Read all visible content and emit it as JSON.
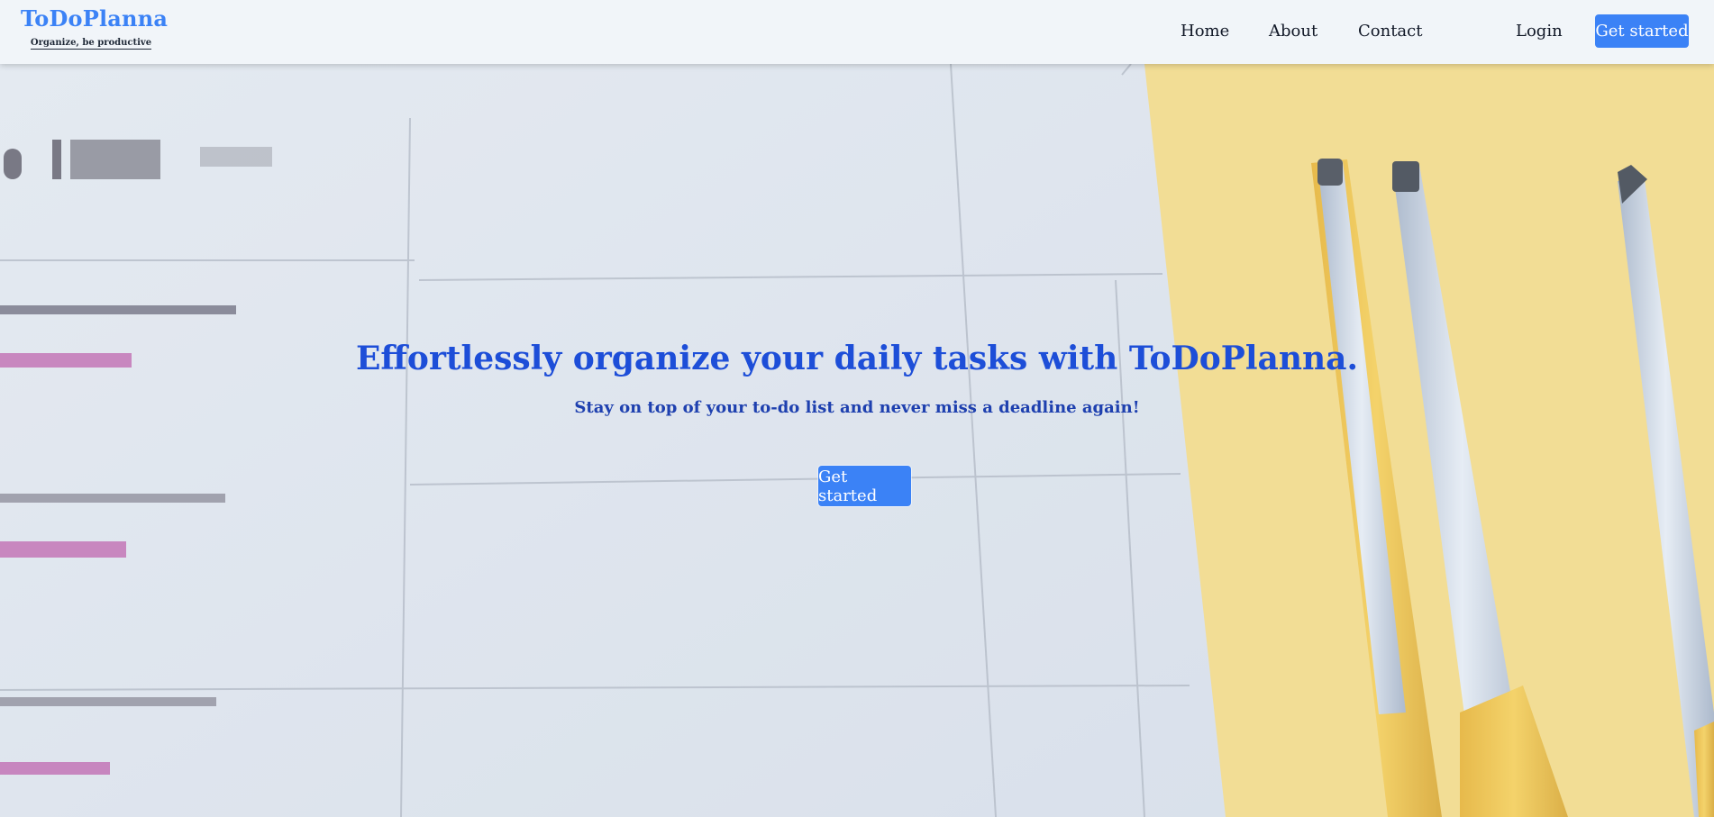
{
  "brand": {
    "name": "ToDoPlanna",
    "tagline": "Organize, be productive"
  },
  "nav": {
    "links": [
      "Home",
      "About",
      "Contact"
    ],
    "login": "Login",
    "cta": "Get started"
  },
  "hero": {
    "title": "Effortlessly organize your daily tasks with ToDoPlanna.",
    "subtitle": "Stay on top of your to-do list and never miss a deadline again!",
    "cta": "Get started"
  },
  "colors": {
    "brand": "#3b82f6",
    "hero_title": "#1d4ed8",
    "nav_bg": "#f1f5f9",
    "accent_yellow": "#f6d36b"
  }
}
